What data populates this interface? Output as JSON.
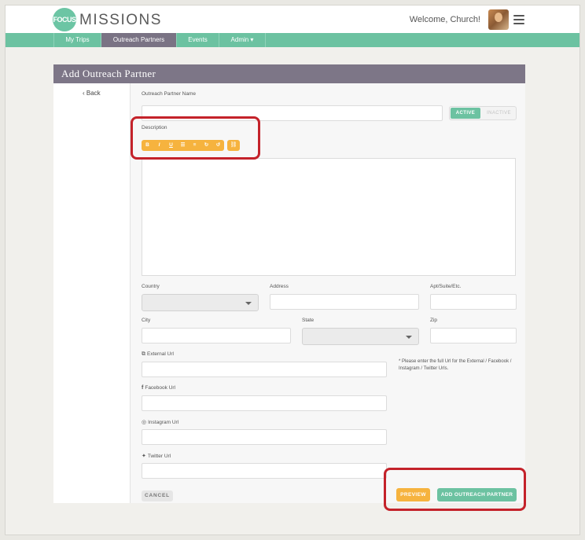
{
  "header": {
    "logo_badge": "FOCUS",
    "logo_text": "MISSIONS",
    "welcome": "Welcome, Church!"
  },
  "nav": [
    {
      "label": "My Trips"
    },
    {
      "label": "Outreach Partners"
    },
    {
      "label": "Events"
    },
    {
      "label": "Admin ▾"
    }
  ],
  "page": {
    "title": "Add Outreach Partner",
    "back": "‹ Back"
  },
  "form": {
    "name_label": "Outreach Partner Name",
    "toggle_on": "ACTIVE",
    "toggle_off": "INACTIVE",
    "description_label": "Description",
    "toolbar": [
      "B",
      "I",
      "U",
      "☰",
      "≡",
      "↻",
      "↺"
    ],
    "link_btn": "⛓",
    "country_label": "Country",
    "address_label": "Address",
    "apt_label": "Apt/Suite/Etc.",
    "city_label": "City",
    "state_label": "State",
    "zip_label": "Zip",
    "external_label": "External Url",
    "facebook_label": "Facebook Url",
    "instagram_label": "Instagram Url",
    "twitter_label": "Twitter Url",
    "url_note": "* Please enter the full Url for the External / Facebook / Instagram / Twitter Urls."
  },
  "actions": {
    "cancel": "CANCEL",
    "preview": "PREVIEW",
    "add": "ADD OUTREACH PARTNER"
  }
}
